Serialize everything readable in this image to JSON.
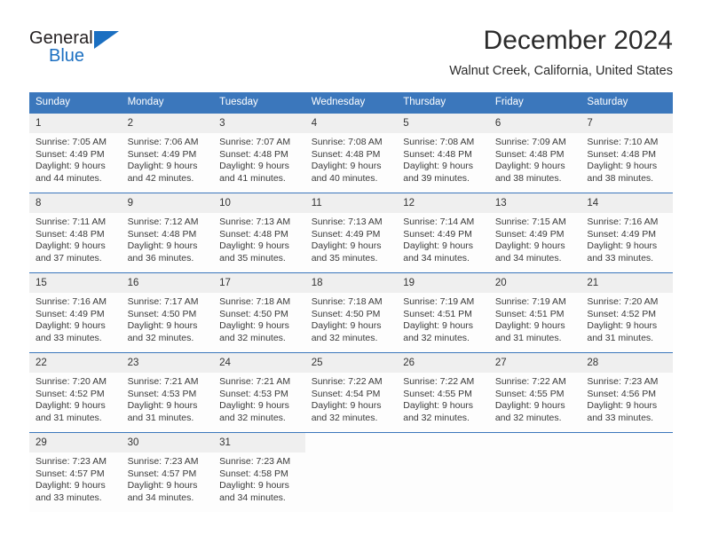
{
  "logo": {
    "word_one": "General",
    "word_two": "Blue",
    "triangle_color": "#1b6fc1",
    "icon": "triangle-icon"
  },
  "header": {
    "title": "December 2024",
    "location": "Walnut Creek, California, United States"
  },
  "colors": {
    "header_blue": "#3b77bc",
    "daynum_gray": "#efefef",
    "text": "#3a3a3a"
  },
  "calendar": {
    "weekday_headers": [
      "Sunday",
      "Monday",
      "Tuesday",
      "Wednesday",
      "Thursday",
      "Friday",
      "Saturday"
    ],
    "weeks": [
      [
        {
          "day": "1",
          "sunrise": "Sunrise: 7:05 AM",
          "sunset": "Sunset: 4:49 PM",
          "daylight_line1": "Daylight: 9 hours",
          "daylight_line2": "and 44 minutes."
        },
        {
          "day": "2",
          "sunrise": "Sunrise: 7:06 AM",
          "sunset": "Sunset: 4:49 PM",
          "daylight_line1": "Daylight: 9 hours",
          "daylight_line2": "and 42 minutes."
        },
        {
          "day": "3",
          "sunrise": "Sunrise: 7:07 AM",
          "sunset": "Sunset: 4:48 PM",
          "daylight_line1": "Daylight: 9 hours",
          "daylight_line2": "and 41 minutes."
        },
        {
          "day": "4",
          "sunrise": "Sunrise: 7:08 AM",
          "sunset": "Sunset: 4:48 PM",
          "daylight_line1": "Daylight: 9 hours",
          "daylight_line2": "and 40 minutes."
        },
        {
          "day": "5",
          "sunrise": "Sunrise: 7:08 AM",
          "sunset": "Sunset: 4:48 PM",
          "daylight_line1": "Daylight: 9 hours",
          "daylight_line2": "and 39 minutes."
        },
        {
          "day": "6",
          "sunrise": "Sunrise: 7:09 AM",
          "sunset": "Sunset: 4:48 PM",
          "daylight_line1": "Daylight: 9 hours",
          "daylight_line2": "and 38 minutes."
        },
        {
          "day": "7",
          "sunrise": "Sunrise: 7:10 AM",
          "sunset": "Sunset: 4:48 PM",
          "daylight_line1": "Daylight: 9 hours",
          "daylight_line2": "and 38 minutes."
        }
      ],
      [
        {
          "day": "8",
          "sunrise": "Sunrise: 7:11 AM",
          "sunset": "Sunset: 4:48 PM",
          "daylight_line1": "Daylight: 9 hours",
          "daylight_line2": "and 37 minutes."
        },
        {
          "day": "9",
          "sunrise": "Sunrise: 7:12 AM",
          "sunset": "Sunset: 4:48 PM",
          "daylight_line1": "Daylight: 9 hours",
          "daylight_line2": "and 36 minutes."
        },
        {
          "day": "10",
          "sunrise": "Sunrise: 7:13 AM",
          "sunset": "Sunset: 4:48 PM",
          "daylight_line1": "Daylight: 9 hours",
          "daylight_line2": "and 35 minutes."
        },
        {
          "day": "11",
          "sunrise": "Sunrise: 7:13 AM",
          "sunset": "Sunset: 4:49 PM",
          "daylight_line1": "Daylight: 9 hours",
          "daylight_line2": "and 35 minutes."
        },
        {
          "day": "12",
          "sunrise": "Sunrise: 7:14 AM",
          "sunset": "Sunset: 4:49 PM",
          "daylight_line1": "Daylight: 9 hours",
          "daylight_line2": "and 34 minutes."
        },
        {
          "day": "13",
          "sunrise": "Sunrise: 7:15 AM",
          "sunset": "Sunset: 4:49 PM",
          "daylight_line1": "Daylight: 9 hours",
          "daylight_line2": "and 34 minutes."
        },
        {
          "day": "14",
          "sunrise": "Sunrise: 7:16 AM",
          "sunset": "Sunset: 4:49 PM",
          "daylight_line1": "Daylight: 9 hours",
          "daylight_line2": "and 33 minutes."
        }
      ],
      [
        {
          "day": "15",
          "sunrise": "Sunrise: 7:16 AM",
          "sunset": "Sunset: 4:49 PM",
          "daylight_line1": "Daylight: 9 hours",
          "daylight_line2": "and 33 minutes."
        },
        {
          "day": "16",
          "sunrise": "Sunrise: 7:17 AM",
          "sunset": "Sunset: 4:50 PM",
          "daylight_line1": "Daylight: 9 hours",
          "daylight_line2": "and 32 minutes."
        },
        {
          "day": "17",
          "sunrise": "Sunrise: 7:18 AM",
          "sunset": "Sunset: 4:50 PM",
          "daylight_line1": "Daylight: 9 hours",
          "daylight_line2": "and 32 minutes."
        },
        {
          "day": "18",
          "sunrise": "Sunrise: 7:18 AM",
          "sunset": "Sunset: 4:50 PM",
          "daylight_line1": "Daylight: 9 hours",
          "daylight_line2": "and 32 minutes."
        },
        {
          "day": "19",
          "sunrise": "Sunrise: 7:19 AM",
          "sunset": "Sunset: 4:51 PM",
          "daylight_line1": "Daylight: 9 hours",
          "daylight_line2": "and 32 minutes."
        },
        {
          "day": "20",
          "sunrise": "Sunrise: 7:19 AM",
          "sunset": "Sunset: 4:51 PM",
          "daylight_line1": "Daylight: 9 hours",
          "daylight_line2": "and 31 minutes."
        },
        {
          "day": "21",
          "sunrise": "Sunrise: 7:20 AM",
          "sunset": "Sunset: 4:52 PM",
          "daylight_line1": "Daylight: 9 hours",
          "daylight_line2": "and 31 minutes."
        }
      ],
      [
        {
          "day": "22",
          "sunrise": "Sunrise: 7:20 AM",
          "sunset": "Sunset: 4:52 PM",
          "daylight_line1": "Daylight: 9 hours",
          "daylight_line2": "and 31 minutes."
        },
        {
          "day": "23",
          "sunrise": "Sunrise: 7:21 AM",
          "sunset": "Sunset: 4:53 PM",
          "daylight_line1": "Daylight: 9 hours",
          "daylight_line2": "and 31 minutes."
        },
        {
          "day": "24",
          "sunrise": "Sunrise: 7:21 AM",
          "sunset": "Sunset: 4:53 PM",
          "daylight_line1": "Daylight: 9 hours",
          "daylight_line2": "and 32 minutes."
        },
        {
          "day": "25",
          "sunrise": "Sunrise: 7:22 AM",
          "sunset": "Sunset: 4:54 PM",
          "daylight_line1": "Daylight: 9 hours",
          "daylight_line2": "and 32 minutes."
        },
        {
          "day": "26",
          "sunrise": "Sunrise: 7:22 AM",
          "sunset": "Sunset: 4:55 PM",
          "daylight_line1": "Daylight: 9 hours",
          "daylight_line2": "and 32 minutes."
        },
        {
          "day": "27",
          "sunrise": "Sunrise: 7:22 AM",
          "sunset": "Sunset: 4:55 PM",
          "daylight_line1": "Daylight: 9 hours",
          "daylight_line2": "and 32 minutes."
        },
        {
          "day": "28",
          "sunrise": "Sunrise: 7:23 AM",
          "sunset": "Sunset: 4:56 PM",
          "daylight_line1": "Daylight: 9 hours",
          "daylight_line2": "and 33 minutes."
        }
      ],
      [
        {
          "day": "29",
          "sunrise": "Sunrise: 7:23 AM",
          "sunset": "Sunset: 4:57 PM",
          "daylight_line1": "Daylight: 9 hours",
          "daylight_line2": "and 33 minutes."
        },
        {
          "day": "30",
          "sunrise": "Sunrise: 7:23 AM",
          "sunset": "Sunset: 4:57 PM",
          "daylight_line1": "Daylight: 9 hours",
          "daylight_line2": "and 34 minutes."
        },
        {
          "day": "31",
          "sunrise": "Sunrise: 7:23 AM",
          "sunset": "Sunset: 4:58 PM",
          "daylight_line1": "Daylight: 9 hours",
          "daylight_line2": "and 34 minutes."
        },
        {
          "day": "",
          "sunrise": "",
          "sunset": "",
          "daylight_line1": "",
          "daylight_line2": ""
        },
        {
          "day": "",
          "sunrise": "",
          "sunset": "",
          "daylight_line1": "",
          "daylight_line2": ""
        },
        {
          "day": "",
          "sunrise": "",
          "sunset": "",
          "daylight_line1": "",
          "daylight_line2": ""
        },
        {
          "day": "",
          "sunrise": "",
          "sunset": "",
          "daylight_line1": "",
          "daylight_line2": ""
        }
      ]
    ]
  }
}
